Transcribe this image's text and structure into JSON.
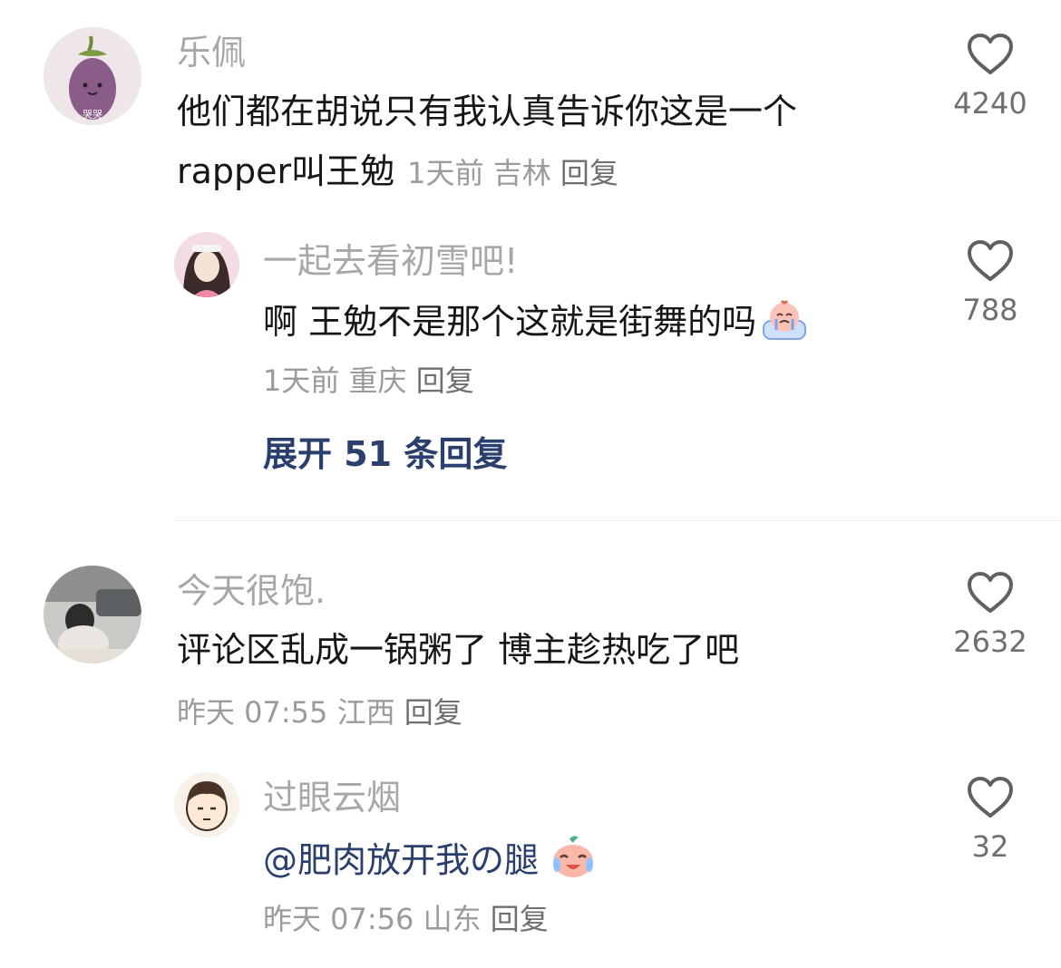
{
  "comments": [
    {
      "name": "乐佩",
      "text_line1": "他们都在胡说只有我认真告诉你这是一个",
      "text_line2": "rapper叫王勉",
      "time": "1天前",
      "location": "吉林",
      "reply_label": "回复",
      "likes": "4240",
      "avatar_caption": "哭哭",
      "replies": [
        {
          "name": "一起去看初雪吧!",
          "text": "啊 王勉不是那个这就是街舞的吗",
          "emoji": "crying-peach-emoji",
          "time": "1天前",
          "location": "重庆",
          "reply_label": "回复",
          "likes": "788"
        }
      ],
      "expand_label": "展开 51 条回复"
    },
    {
      "name": "今天很饱.",
      "text": "评论区乱成一锅粥了 博主趁热吃了吧",
      "time": "昨天 07:55",
      "location": "江西",
      "reply_label": "回复",
      "likes": "2632",
      "replies": [
        {
          "name": "过眼云烟",
          "text": "@肥肉放开我の腿",
          "emoji": "laughing-crying-peach-emoji",
          "time": "昨天 07:56",
          "location": "山东",
          "reply_label": "回复",
          "likes": "32"
        }
      ]
    }
  ],
  "colors": {
    "name": "#a7a7ab",
    "text": "#16161a",
    "meta": "#9a9aa0",
    "link": "#2a3f6e",
    "divider": "#ececef"
  }
}
